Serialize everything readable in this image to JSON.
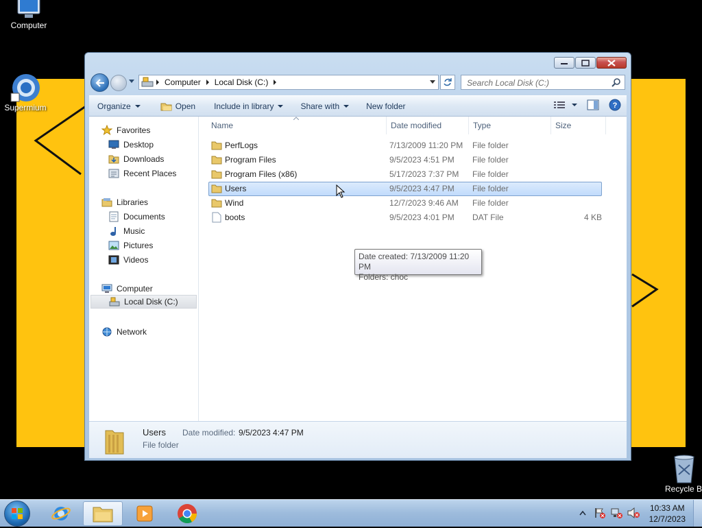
{
  "desktop": {
    "icons": [
      {
        "label": "Computer",
        "icon": "computer-icon"
      },
      {
        "label": "Supermium",
        "icon": "supermium-icon"
      },
      {
        "label": "Recycle Bi",
        "icon": "recycle-bin-icon"
      }
    ],
    "wallpaper_color": "#ffc30f"
  },
  "window": {
    "caption": {
      "minimize": "minimize-icon",
      "maximize": "maximize-icon",
      "close": "close-icon"
    },
    "address": {
      "crumbs": [
        "Computer",
        "Local Disk (C:)"
      ]
    },
    "search": {
      "placeholder": "Search Local Disk (C:)"
    },
    "toolbar": {
      "organize": "Organize",
      "open": "Open",
      "include": "Include in library",
      "share": "Share with",
      "new_folder": "New folder"
    },
    "navpane": {
      "favorites": "Favorites",
      "desktop": "Desktop",
      "downloads": "Downloads",
      "recent": "Recent Places",
      "libraries": "Libraries",
      "documents": "Documents",
      "music": "Music",
      "pictures": "Pictures",
      "videos": "Videos",
      "computer": "Computer",
      "local_disk": "Local Disk (C:)",
      "network": "Network"
    },
    "columns": {
      "name": "Name",
      "date": "Date modified",
      "type": "Type",
      "size": "Size"
    },
    "files": [
      {
        "name": "PerfLogs",
        "date": "7/13/2009 11:20 PM",
        "type": "File folder",
        "size": ""
      },
      {
        "name": "Program Files",
        "date": "9/5/2023 4:51 PM",
        "type": "File folder",
        "size": ""
      },
      {
        "name": "Program Files (x86)",
        "date": "5/17/2023 7:37 PM",
        "type": "File folder",
        "size": ""
      },
      {
        "name": "Users",
        "date": "9/5/2023 4:47 PM",
        "type": "File folder",
        "size": ""
      },
      {
        "name": "Wind",
        "date": "12/7/2023 9:46 AM",
        "type": "File folder",
        "size": ""
      },
      {
        "name": "boots",
        "date": "9/5/2023 4:01 PM",
        "type": "DAT File",
        "size": "4 KB"
      }
    ],
    "tooltip": {
      "line1": "Date created: 7/13/2009 11:20 PM",
      "line2": "Folders: choc"
    },
    "details": {
      "name": "Users",
      "kind": "File folder",
      "date_label": "Date modified:",
      "date_value": "9/5/2023 4:47 PM"
    }
  },
  "taskbar": {
    "clock_time": "10:33 AM",
    "clock_date": "12/7/2023"
  }
}
